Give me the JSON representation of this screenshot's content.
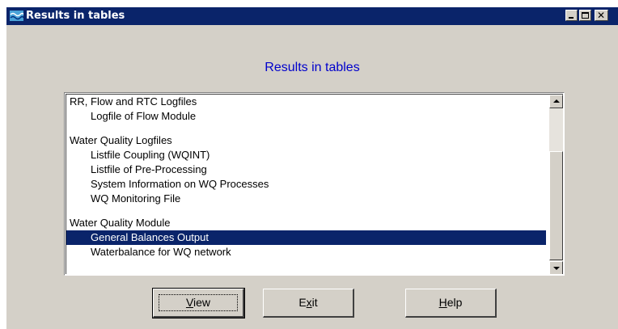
{
  "window": {
    "title": "Results in tables",
    "title_bar_color": "#0a246a",
    "app_icon": "wave-icon",
    "controls": [
      "minimize-icon",
      "maximize-icon",
      "close-icon"
    ]
  },
  "heading": "Results in tables",
  "list": {
    "items": [
      {
        "label": "RR, Flow and RTC Logfiles",
        "type": "group"
      },
      {
        "label": "Logfile of Flow Module",
        "type": "child"
      },
      {
        "label": "",
        "type": "gap"
      },
      {
        "label": "Water Quality Logfiles",
        "type": "group"
      },
      {
        "label": "Listfile Coupling (WQINT)",
        "type": "child"
      },
      {
        "label": "Listfile of Pre-Processing",
        "type": "child"
      },
      {
        "label": "System Information on WQ Processes",
        "type": "child"
      },
      {
        "label": "WQ Monitoring File",
        "type": "child"
      },
      {
        "label": "",
        "type": "gap"
      },
      {
        "label": "Water Quality Module",
        "type": "group"
      },
      {
        "label": "General Balances Output",
        "type": "child",
        "selected": true
      },
      {
        "label": "Waterbalance for WQ network",
        "type": "child"
      }
    ],
    "selected_color": "#0a246a"
  },
  "buttons": {
    "view": {
      "label_pre": "",
      "label_mnemonic": "V",
      "label_post": "iew"
    },
    "exit": {
      "label_pre": "E",
      "label_mnemonic": "x",
      "label_post": "it"
    },
    "help": {
      "label_pre": "",
      "label_mnemonic": "H",
      "label_post": "elp"
    }
  }
}
